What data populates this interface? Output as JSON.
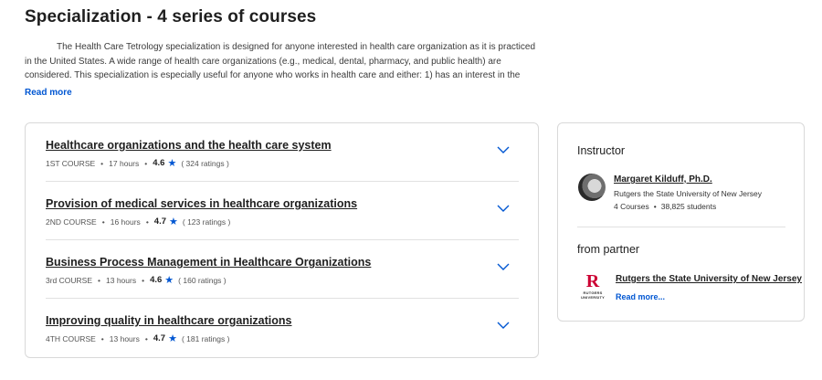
{
  "header": {
    "title": "Specialization - 4 series of courses"
  },
  "description": {
    "text": "The Health Care Tetrology specialization is designed for anyone interested in health care organization as it is practiced in the United States. A wide range of health care organizations (e.g., medical, dental, pharmacy, and public health) are considered. This specialization is especially useful for anyone who works in health care and either: 1) has an interest in the issues important to the",
    "read_more": "Read more"
  },
  "courses": [
    {
      "title": "Healthcare organizations and the health care system",
      "number": "1ST COURSE",
      "hours": "17 hours",
      "rating": "4.6",
      "ratings_count": "( 324 ratings )"
    },
    {
      "title": "Provision of medical services in healthcare organizations",
      "number": "2ND COURSE",
      "hours": "16 hours",
      "rating": "4.7",
      "ratings_count": "( 123 ratings )"
    },
    {
      "title": "Business Process Management in Healthcare Organizations",
      "number": "3rd COURSE",
      "hours": "13 hours",
      "rating": "4.6",
      "ratings_count": "( 160 ratings )"
    },
    {
      "title": "Improving quality in healthcare organizations",
      "number": "4TH COURSE",
      "hours": "13 hours",
      "rating": "4.7",
      "ratings_count": "( 181 ratings )"
    }
  ],
  "sidebar": {
    "instructor_heading": "Instructor",
    "instructor": {
      "name": "Margaret Kilduff, Ph.D.",
      "org": "Rutgers the State University of New Jersey",
      "courses": "4 Courses",
      "students": "38,825 students"
    },
    "partner_heading": "from partner",
    "partner": {
      "logo_letter": "R",
      "logo_text": "RUTGERS UNIVERSITY",
      "name": "Rutgers the State University of New Jersey",
      "read_more": "Read more..."
    }
  },
  "colors": {
    "accent": "#0056d2",
    "rutgers_red": "#cc0033"
  },
  "icons": {
    "star": "star-icon",
    "chevron": "chevron-down-icon"
  }
}
